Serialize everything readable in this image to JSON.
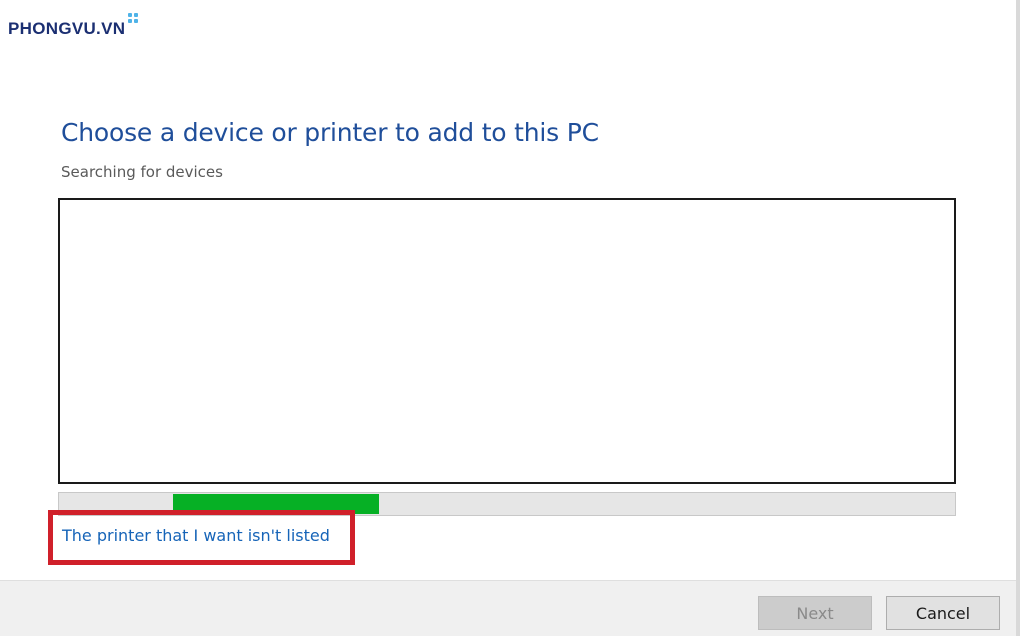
{
  "watermark": {
    "text": "PHONGVU.VN"
  },
  "dialog": {
    "title": "Choose a device or printer to add to this PC",
    "status": "Searching for devices",
    "device_list": [],
    "progress": {
      "segment_start_fraction": 0.127,
      "segment_end_fraction": 0.357,
      "fill_color": "#06b025"
    },
    "link_text": "The printer that I want isn't listed",
    "highlight_color": "#d0202a"
  },
  "buttons": {
    "next_label": "Next",
    "cancel_label": "Cancel"
  }
}
